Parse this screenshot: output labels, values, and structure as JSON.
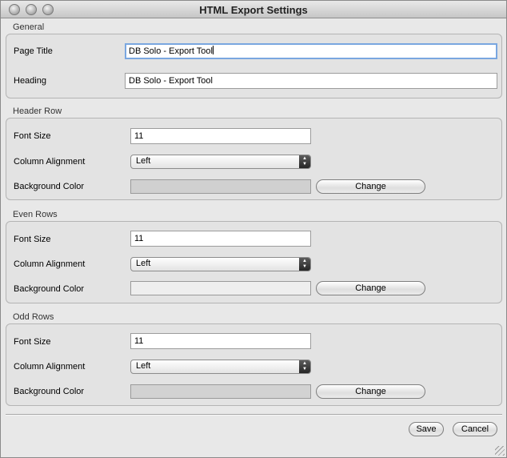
{
  "window": {
    "title": "HTML Export Settings"
  },
  "colors": {
    "header_bg": "#d0d0d0",
    "even_bg": "#eeeeee",
    "odd_bg": "#d2d2d2"
  },
  "general": {
    "label": "General",
    "page_title_label": "Page Title",
    "page_title_value": "DB Solo - Export Tool",
    "heading_label": "Heading",
    "heading_value": "DB Solo - Export Tool"
  },
  "header_row": {
    "label": "Header Row",
    "font_size_label": "Font Size",
    "font_size_value": "11",
    "alignment_label": "Column Alignment",
    "alignment_value": "Left",
    "bg_label": "Background Color",
    "change_label": "Change"
  },
  "even_rows": {
    "label": "Even Rows",
    "font_size_label": "Font Size",
    "font_size_value": "11",
    "alignment_label": "Column Alignment",
    "alignment_value": "Left",
    "bg_label": "Background Color",
    "change_label": "Change"
  },
  "odd_rows": {
    "label": "Odd Rows",
    "font_size_label": "Font Size",
    "font_size_value": "11",
    "alignment_label": "Column Alignment",
    "alignment_value": "Left",
    "bg_label": "Background Color",
    "change_label": "Change"
  },
  "footer": {
    "save_label": "Save",
    "cancel_label": "Cancel"
  }
}
